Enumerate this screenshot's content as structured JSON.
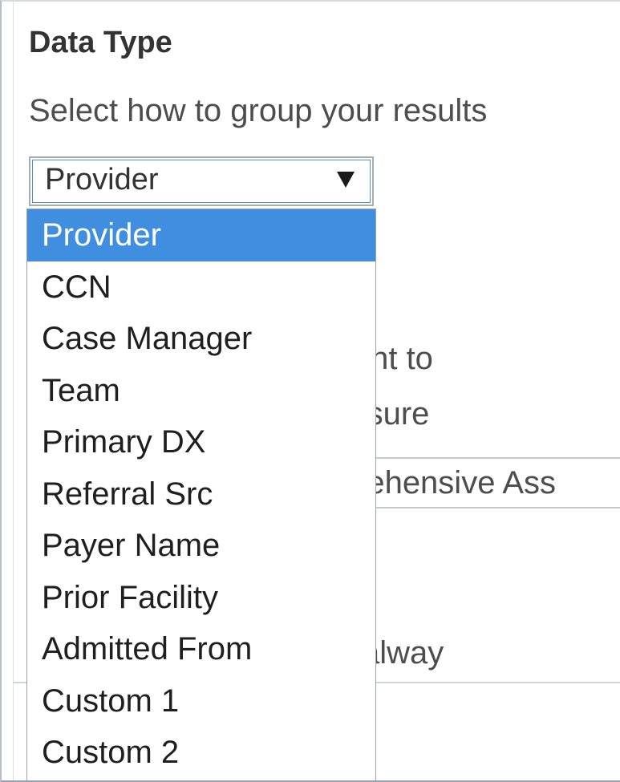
{
  "panel": {
    "title": "Data Type",
    "help_line_1": "Select how to group your results",
    "help_line_2": "e you want to",
    "help_line_3": "s or measure",
    "help_line_4": "luded is alway"
  },
  "group_select": {
    "value": "Provider",
    "options": [
      "Provider",
      "CCN",
      "Case Manager",
      "Team",
      "Primary DX",
      "Referral Src",
      "Payer Name",
      "Prior Facility",
      "Admitted From",
      "Custom 1",
      "Custom 2"
    ],
    "highlighted_index": 0
  },
  "measure_select": {
    "value": "rehensive Ass"
  },
  "colors": {
    "highlight": "#3f8ee0",
    "focus_ring": "#4a90d9"
  }
}
